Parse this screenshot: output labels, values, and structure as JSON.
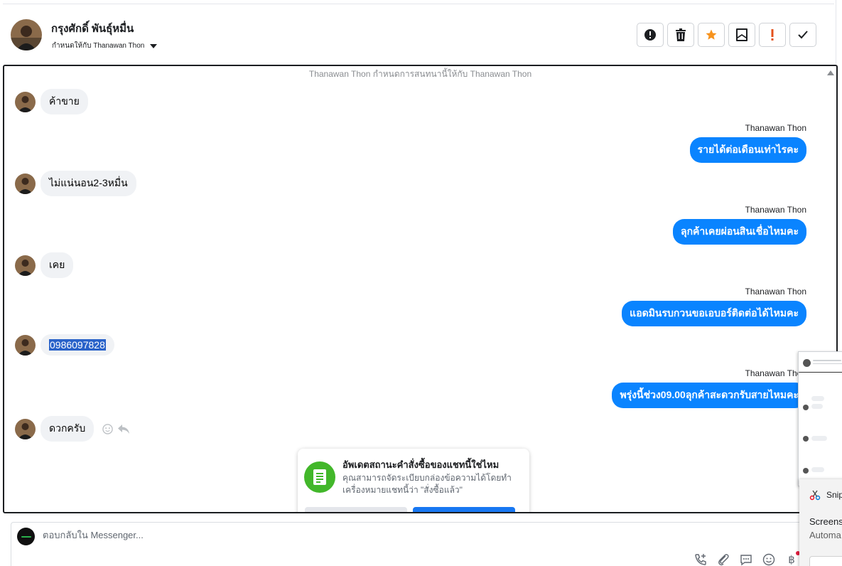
{
  "header": {
    "contact_name": "กรุงศักดิ์ พันธุ์หมื่น",
    "assigned_to": "กำหนดให้กับ Thanawan Thon"
  },
  "actions": [
    {
      "name": "report-icon"
    },
    {
      "name": "trash-icon"
    },
    {
      "name": "star-icon"
    },
    {
      "name": "archive-mail-icon"
    },
    {
      "name": "important-icon"
    },
    {
      "name": "checkmark-icon"
    }
  ],
  "colors": {
    "outgoing_bubble": "#0a84ff",
    "incoming_bubble": "#f0f2f5",
    "star": "#f7931e",
    "important": "#e4521c",
    "promo_icon": "#42b72a",
    "primary_button": "#1877f2"
  },
  "chat": {
    "system_note": "Thanawan Thon กำหนดการสนทนานี้ให้กับ Thanawan Thon",
    "messages": [
      {
        "dir": "in",
        "text": "ค้าขาย"
      },
      {
        "dir": "out",
        "sender": "Thanawan Thon",
        "text": "รายได้ต่อเดือนเท่าไรคะ"
      },
      {
        "dir": "in",
        "text": "ไม่แน่นอน2-3หมื่น"
      },
      {
        "dir": "out",
        "sender": "Thanawan Thon",
        "text": "ลุกค้าเคยผ่อนสินเชื่อไหมคะ"
      },
      {
        "dir": "in",
        "text": "เคย"
      },
      {
        "dir": "out",
        "sender": "Thanawan Thon",
        "text": "แอดมินรบกวนขอเอบอร์ติดต่อได้ไหมคะ"
      },
      {
        "dir": "in",
        "text": "0986097828"
      },
      {
        "dir": "out",
        "sender": "Thanawan Thon",
        "text": "พรุ่งนี้ช่วง09.00ลุกค้าสะดวกรับสายไหมคะ"
      },
      {
        "dir": "in",
        "text": "ดวกครับ"
      }
    ]
  },
  "promo": {
    "title": "อัพเดตสถานะคำสั่งซื้อของแชทนี้ใช่ไหม",
    "description": "คุณสามารถจัดระเบียบกล่องข้อความได้โดยทำเครื่องหมายแชทนี้ว่า \"สั่งซื้อแล้ว\""
  },
  "composer": {
    "placeholder": "ตอบกลับใน Messenger..."
  },
  "composer_tools": [
    {
      "name": "phone-add-icon"
    },
    {
      "name": "paperclip-icon"
    },
    {
      "name": "chat-bubble-icon"
    },
    {
      "name": "emoji-icon"
    },
    {
      "name": "baht-icon",
      "glyph": "฿"
    }
  ],
  "snip": {
    "title": "Snip",
    "line1": "Screens",
    "line2": "Automa"
  }
}
